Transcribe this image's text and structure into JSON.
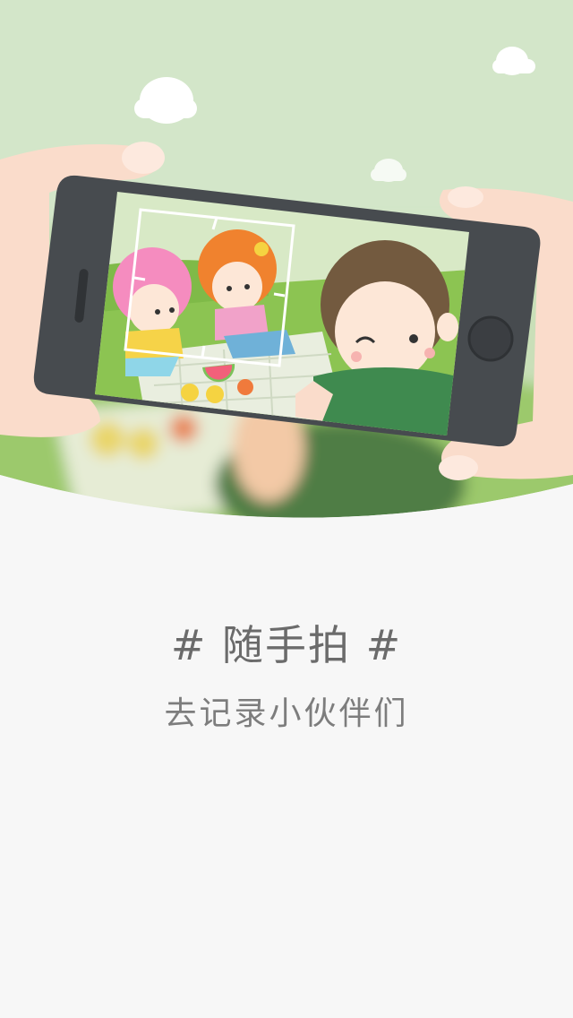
{
  "intro": {
    "title": "# 随手拍 #",
    "subtitle": "去记录小伙伴们"
  },
  "theme": {
    "background": "#f7f7f7",
    "sky": "#d3e6c9",
    "grass": "#8fc55a",
    "text_primary": "#6b6b6b",
    "text_secondary": "#7d7d7d"
  },
  "icons": [
    "cloud-icon",
    "phone-illustration",
    "focus-frame-icon",
    "home-button-icon"
  ]
}
